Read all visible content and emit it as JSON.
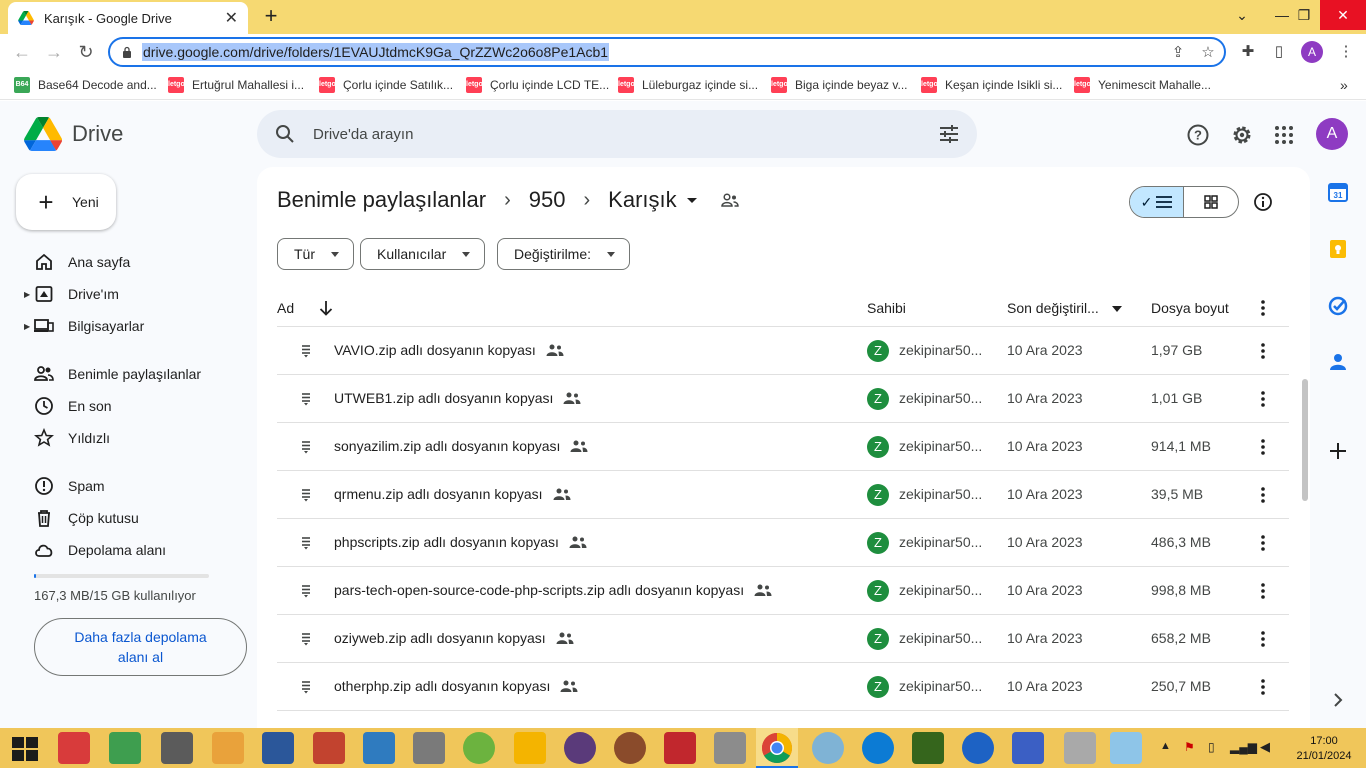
{
  "browser": {
    "tab_title": "Karışık - Google Drive",
    "url": "drive.google.com/drive/folders/1EVAUJtdmcK9Ga_QrZZWc2o6o8Pe1Acb1",
    "profile_initial": "A",
    "bookmarks": [
      {
        "label": "Base64 Decode and...",
        "icon": "b64-icon",
        "color": "#3aa757"
      },
      {
        "label": "Ertuğrul Mahallesi i...",
        "icon": "letgo-icon",
        "color": "#ff3f55"
      },
      {
        "label": "Çorlu içinde Satılık...",
        "icon": "letgo-icon",
        "color": "#ff3f55"
      },
      {
        "label": "Çorlu içinde LCD TE...",
        "icon": "letgo-icon",
        "color": "#ff3f55"
      },
      {
        "label": "Lüleburgaz içinde si...",
        "icon": "letgo-icon",
        "color": "#ff3f55"
      },
      {
        "label": "Biga içinde beyaz v...",
        "icon": "letgo-icon",
        "color": "#ff3f55"
      },
      {
        "label": "Keşan içinde Isikli si...",
        "icon": "letgo-icon",
        "color": "#ff3f55"
      },
      {
        "label": "Yenimescit Mahalle...",
        "icon": "letgo-icon",
        "color": "#ff3f55"
      }
    ],
    "bookmark_icon_text": {
      "b64": "B64",
      "letgo": "letgo"
    }
  },
  "drive": {
    "logo_text": "Drive",
    "search_placeholder": "Drive'da arayın",
    "account_initial": "A",
    "new_label": "Yeni",
    "nav": [
      {
        "label": "Ana sayfa",
        "icon": "home-icon"
      },
      {
        "label": "Drive'ım",
        "icon": "my-drive-icon"
      },
      {
        "label": "Bilgisayarlar",
        "icon": "computers-icon"
      },
      {
        "label": "Benimle paylaşılanlar",
        "icon": "shared-icon"
      },
      {
        "label": "En son",
        "icon": "clock-icon"
      },
      {
        "label": "Yıldızlı",
        "icon": "star-icon"
      },
      {
        "label": "Spam",
        "icon": "spam-icon"
      },
      {
        "label": "Çöp kutusu",
        "icon": "trash-icon"
      },
      {
        "label": "Depolama alanı",
        "icon": "cloud-icon"
      }
    ],
    "storage_used_fraction": 0.011,
    "storage_text": "167,3 MB/15 GB kullanılıyor",
    "more_storage_label": "Daha fazla depolama alanı al",
    "breadcrumb": [
      "Benimle paylaşılanlar",
      "950",
      "Karışık"
    ],
    "filters": [
      "Tür",
      "Kullanıcılar",
      "Değiştirilme:"
    ],
    "columns": {
      "name": "Ad",
      "owner": "Sahibi",
      "modified": "Son değiştiril...",
      "size": "Dosya boyut"
    },
    "owner_initial": "Z",
    "accent": "#1e8e3e",
    "files": [
      {
        "name": "VAVIO.zip adlı dosyanın kopyası",
        "owner": "zekipinar50...",
        "modified": "10 Ara 2023",
        "size": "1,97 GB"
      },
      {
        "name": "UTWEB1.zip adlı dosyanın kopyası",
        "owner": "zekipinar50...",
        "modified": "10 Ara 2023",
        "size": "1,01 GB"
      },
      {
        "name": "sonyazilim.zip adlı dosyanın kopyası",
        "owner": "zekipinar50...",
        "modified": "10 Ara 2023",
        "size": "914,1 MB"
      },
      {
        "name": "qrmenu.zip adlı dosyanın kopyası",
        "owner": "zekipinar50...",
        "modified": "10 Ara 2023",
        "size": "39,5 MB"
      },
      {
        "name": "phpscripts.zip adlı dosyanın kopyası",
        "owner": "zekipinar50...",
        "modified": "10 Ara 2023",
        "size": "486,3 MB"
      },
      {
        "name": "pars-tech-open-source-code-php-scripts.zip adlı dosyanın kopyası",
        "owner": "zekipinar50...",
        "modified": "10 Ara 2023",
        "size": "998,8 MB"
      },
      {
        "name": "oziyweb.zip adlı dosyanın kopyası",
        "owner": "zekipinar50...",
        "modified": "10 Ara 2023",
        "size": "658,2 MB"
      },
      {
        "name": "otherphp.zip adlı dosyanın kopyası",
        "owner": "zekipinar50...",
        "modified": "10 Ara 2023",
        "size": "250,7 MB"
      }
    ]
  },
  "taskbar": {
    "time": "17:00",
    "date": "21/01/2024"
  }
}
